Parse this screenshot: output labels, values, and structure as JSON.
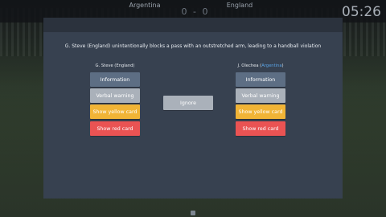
{
  "scoreboard": {
    "home_team": "Argentina",
    "away_team": "England",
    "score": "0 - 0",
    "clock": "05:26"
  },
  "incident": {
    "description": "G. Steve (England) unintentionally blocks a pass with an outstretched arm, leading to a handball violation"
  },
  "left_panel": {
    "player_name": "G. Steve",
    "player_team": "England",
    "actions": [
      "Information",
      "Verbal warning",
      "Show yellow card",
      "Show red card"
    ]
  },
  "right_panel": {
    "player_name": "J. Olechea",
    "player_team": "Argentina",
    "actions": [
      "Information",
      "Verbal warning",
      "Show yellow card",
      "Show red card"
    ]
  },
  "center": {
    "ignore_label": "Ignore"
  },
  "colors": {
    "info": "#5d6e84",
    "verbal": "#aab1ba",
    "yellow": "#f1b436",
    "red": "#ea5353",
    "team_highlight": "#5aa5e8"
  }
}
